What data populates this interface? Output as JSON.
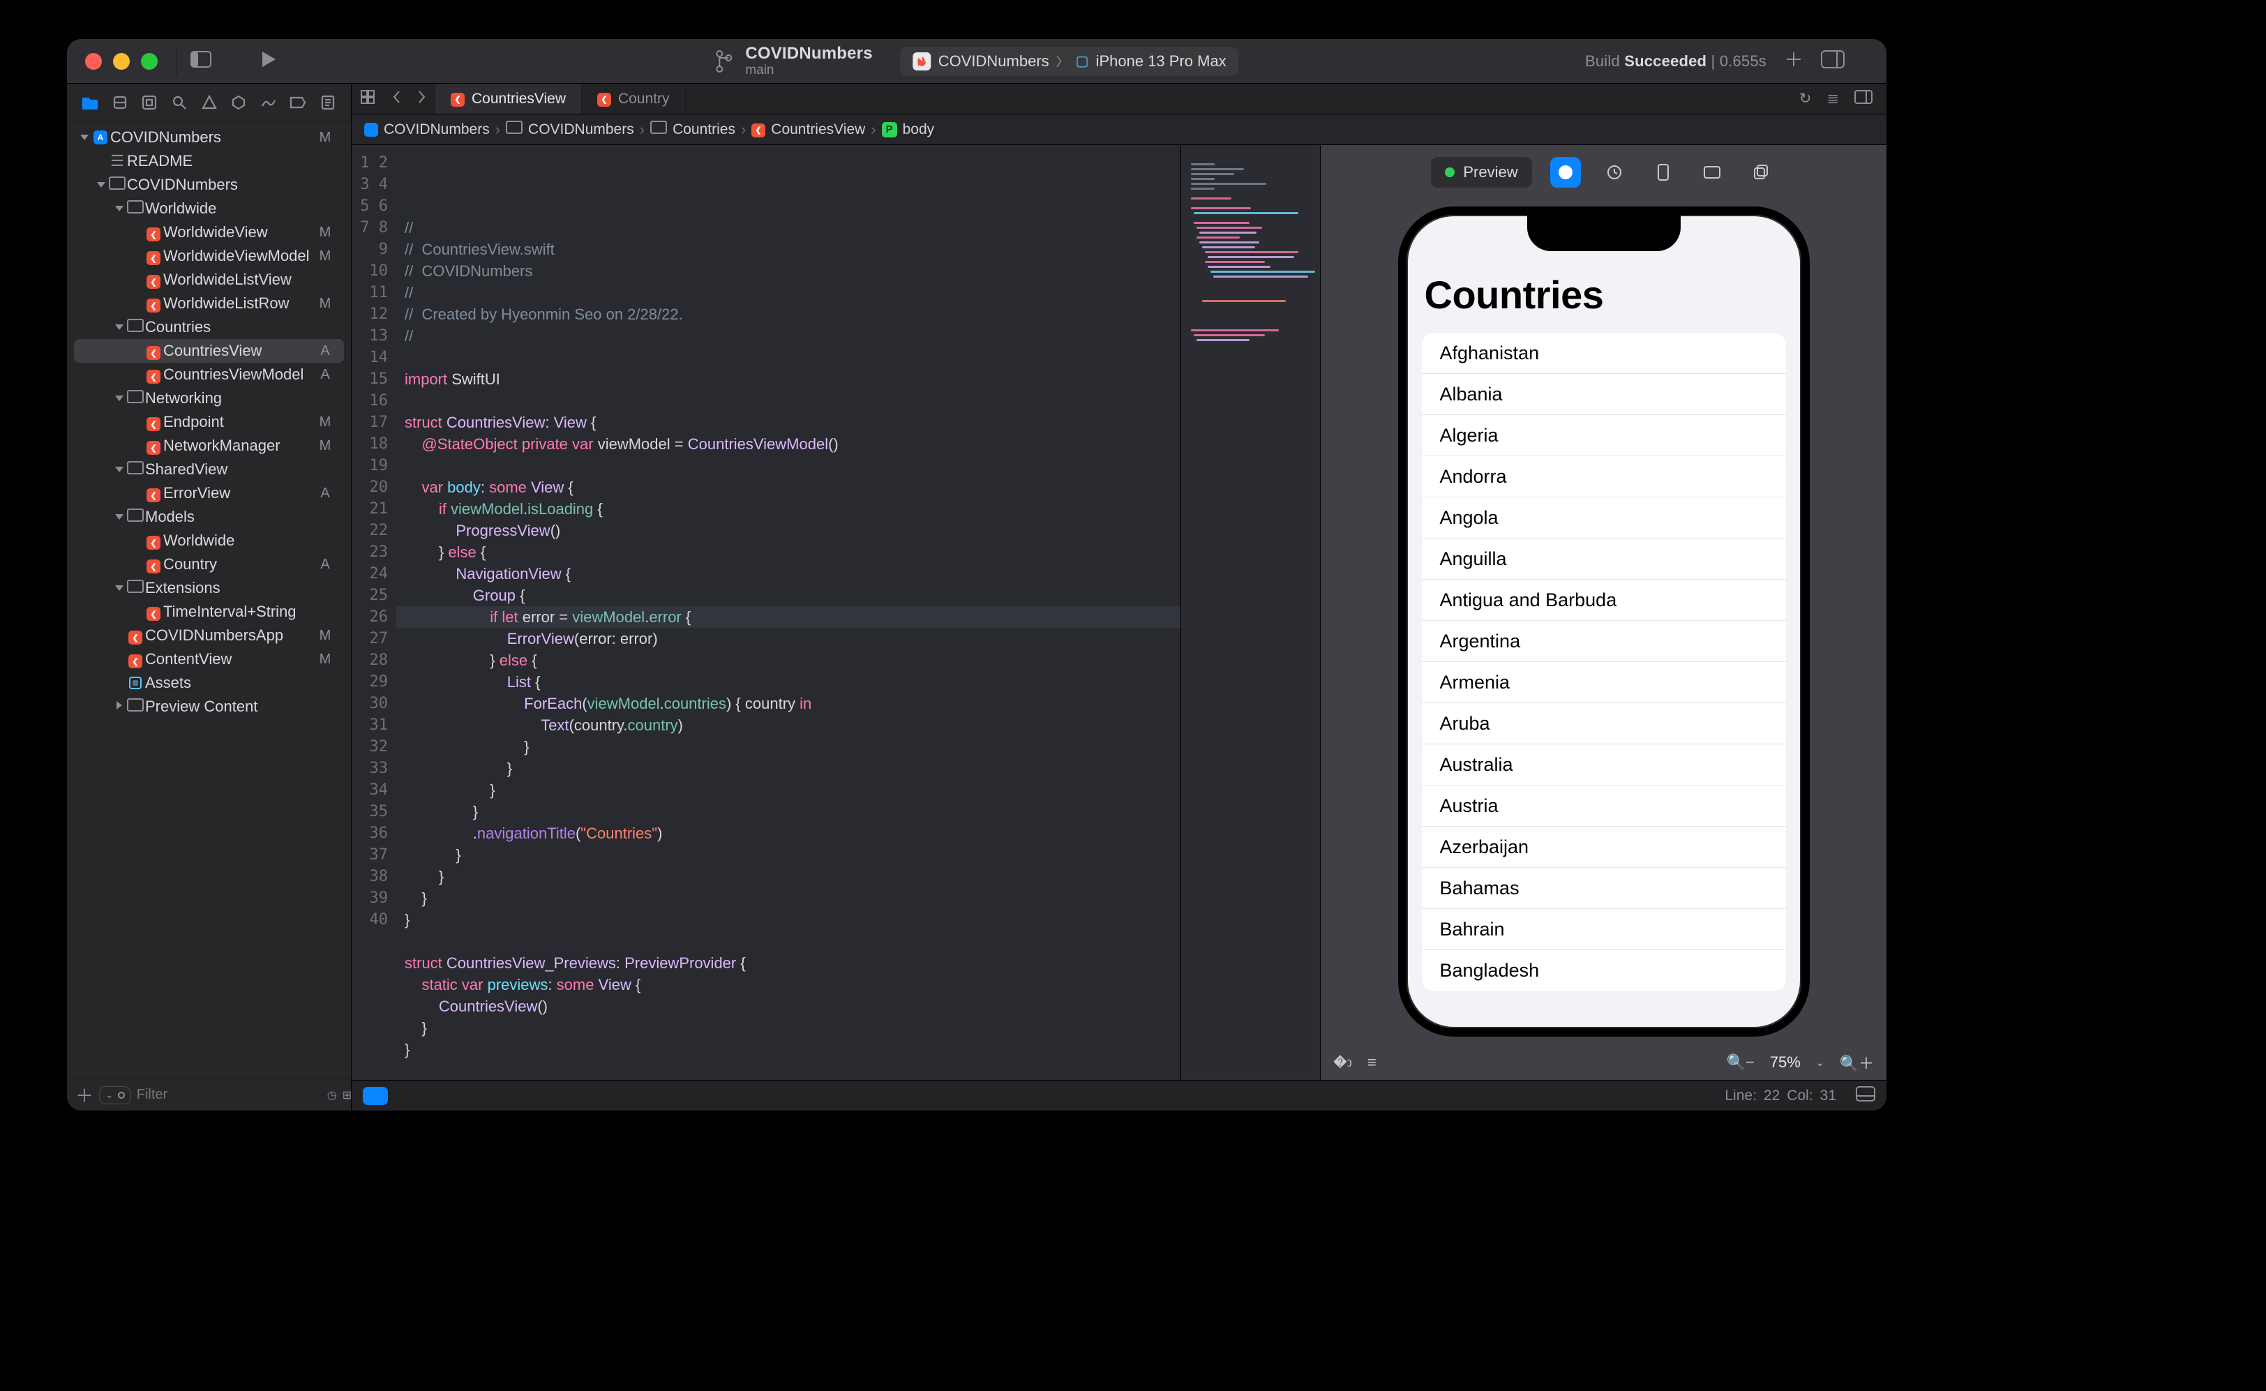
{
  "titlebar": {
    "project_title": "COVIDNumbers",
    "branch": "main",
    "scheme_app": "COVIDNumbers",
    "scheme_device": "iPhone 13 Pro Max",
    "status_prefix": "Build ",
    "status_result": "Succeeded",
    "status_time": " | 0.655s"
  },
  "navigator": {
    "filter_placeholder": "Filter",
    "tree": [
      {
        "indent": 0,
        "kind": "project",
        "label": "COVIDNumbers",
        "badge": "M",
        "open": true
      },
      {
        "indent": 1,
        "kind": "md",
        "label": "README",
        "badge": ""
      },
      {
        "indent": 1,
        "kind": "folder",
        "label": "COVIDNumbers",
        "badge": "",
        "open": true
      },
      {
        "indent": 2,
        "kind": "folder",
        "label": "Worldwide",
        "badge": "",
        "open": true
      },
      {
        "indent": 3,
        "kind": "swift",
        "label": "WorldwideView",
        "badge": "M"
      },
      {
        "indent": 3,
        "kind": "swift",
        "label": "WorldwideViewModel",
        "badge": "M"
      },
      {
        "indent": 3,
        "kind": "swift",
        "label": "WorldwideListView",
        "badge": ""
      },
      {
        "indent": 3,
        "kind": "swift",
        "label": "WorldwideListRow",
        "badge": "M"
      },
      {
        "indent": 2,
        "kind": "folder",
        "label": "Countries",
        "badge": "",
        "open": true
      },
      {
        "indent": 3,
        "kind": "swift",
        "label": "CountriesView",
        "badge": "A",
        "selected": true
      },
      {
        "indent": 3,
        "kind": "swift",
        "label": "CountriesViewModel",
        "badge": "A"
      },
      {
        "indent": 2,
        "kind": "folder",
        "label": "Networking",
        "badge": "",
        "open": true
      },
      {
        "indent": 3,
        "kind": "swift",
        "label": "Endpoint",
        "badge": "M"
      },
      {
        "indent": 3,
        "kind": "swift",
        "label": "NetworkManager",
        "badge": "M"
      },
      {
        "indent": 2,
        "kind": "folder",
        "label": "SharedView",
        "badge": "",
        "open": true
      },
      {
        "indent": 3,
        "kind": "swift",
        "label": "ErrorView",
        "badge": "A"
      },
      {
        "indent": 2,
        "kind": "folder",
        "label": "Models",
        "badge": "",
        "open": true
      },
      {
        "indent": 3,
        "kind": "swift",
        "label": "Worldwide",
        "badge": ""
      },
      {
        "indent": 3,
        "kind": "swift",
        "label": "Country",
        "badge": "A"
      },
      {
        "indent": 2,
        "kind": "folder",
        "label": "Extensions",
        "badge": "",
        "open": true
      },
      {
        "indent": 3,
        "kind": "swift",
        "label": "TimeInterval+String",
        "badge": ""
      },
      {
        "indent": 2,
        "kind": "swift",
        "label": "COVIDNumbersApp",
        "badge": "M"
      },
      {
        "indent": 2,
        "kind": "swift",
        "label": "ContentView",
        "badge": "M"
      },
      {
        "indent": 2,
        "kind": "assets",
        "label": "Assets",
        "badge": ""
      },
      {
        "indent": 2,
        "kind": "folder",
        "label": "Preview Content",
        "badge": "",
        "open": false
      }
    ]
  },
  "tabs": [
    {
      "label": "CountriesView",
      "active": true
    },
    {
      "label": "Country",
      "active": false
    }
  ],
  "jumpbar": [
    "COVIDNumbers",
    "COVIDNumbers",
    "Countries",
    "CountriesView",
    "body"
  ],
  "code": {
    "lines": 40,
    "cursor_line": 22,
    "tokens": [
      [
        [
          "c1",
          "//"
        ]
      ],
      [
        [
          "c1",
          "//  CountriesView.swift"
        ]
      ],
      [
        [
          "c1",
          "//  COVIDNumbers"
        ]
      ],
      [
        [
          "c1",
          "//"
        ]
      ],
      [
        [
          "c1",
          "//  Created by Hyeonmin Seo on 2/28/22."
        ]
      ],
      [
        [
          "c1",
          "//"
        ]
      ],
      [],
      [
        [
          "kw",
          "import"
        ],
        [
          "op",
          " SwiftUI"
        ]
      ],
      [],
      [
        [
          "kw",
          "struct "
        ],
        [
          "ty",
          "CountriesView"
        ],
        [
          "op",
          ": "
        ],
        [
          "ty",
          "View"
        ],
        [
          "op",
          " {"
        ]
      ],
      [
        [
          "op",
          "    "
        ],
        [
          "at",
          "@StateObject"
        ],
        [
          "op",
          " "
        ],
        [
          "kw",
          "private var"
        ],
        [
          "op",
          " "
        ],
        [
          "op",
          "viewModel = "
        ],
        [
          "ty",
          "CountriesViewModel"
        ],
        [
          "op",
          "()"
        ]
      ],
      [],
      [
        [
          "op",
          "    "
        ],
        [
          "kw",
          "var"
        ],
        [
          "op",
          " "
        ],
        [
          "id",
          "body"
        ],
        [
          "op",
          ": "
        ],
        [
          "kw",
          "some"
        ],
        [
          "op",
          " "
        ],
        [
          "ty",
          "View"
        ],
        [
          "op",
          " {"
        ]
      ],
      [
        [
          "op",
          "        "
        ],
        [
          "kw",
          "if"
        ],
        [
          "op",
          " "
        ],
        [
          "va",
          "viewModel"
        ],
        [
          "op",
          "."
        ],
        [
          "va",
          "isLoading"
        ],
        [
          "op",
          " {"
        ]
      ],
      [
        [
          "op",
          "            "
        ],
        [
          "ty",
          "ProgressView"
        ],
        [
          "op",
          "()"
        ]
      ],
      [
        [
          "op",
          "        } "
        ],
        [
          "kw",
          "else"
        ],
        [
          "op",
          " {"
        ]
      ],
      [
        [
          "op",
          "            "
        ],
        [
          "ty",
          "NavigationView"
        ],
        [
          "op",
          " {"
        ]
      ],
      [
        [
          "op",
          "                "
        ],
        [
          "ty",
          "Group"
        ],
        [
          "op",
          " {"
        ]
      ],
      [
        [
          "op",
          "                    "
        ],
        [
          "kw",
          "if let"
        ],
        [
          "op",
          " error = "
        ],
        [
          "va",
          "viewModel"
        ],
        [
          "op",
          "."
        ],
        [
          "va",
          "error"
        ],
        [
          "op",
          " {"
        ]
      ],
      [
        [
          "op",
          "                        "
        ],
        [
          "ty",
          "ErrorView"
        ],
        [
          "op",
          "(error: "
        ],
        [
          "op",
          "error)"
        ]
      ],
      [
        [
          "op",
          "                    } "
        ],
        [
          "kw",
          "else"
        ],
        [
          "op",
          " {"
        ]
      ],
      [
        [
          "op",
          "                        "
        ],
        [
          "ty",
          "List"
        ],
        [
          "op",
          " {"
        ]
      ],
      [
        [
          "op",
          "                            "
        ],
        [
          "ty",
          "ForEach"
        ],
        [
          "op",
          "("
        ],
        [
          "va",
          "viewModel"
        ],
        [
          "op",
          "."
        ],
        [
          "va",
          "countries"
        ],
        [
          "op",
          ") { country "
        ],
        [
          "kw",
          "in"
        ]
      ],
      [
        [
          "op",
          "                                "
        ],
        [
          "ty",
          "Text"
        ],
        [
          "op",
          "("
        ],
        [
          "op",
          "country."
        ],
        [
          "va",
          "country"
        ],
        [
          "op",
          ")"
        ]
      ],
      [
        [
          "op",
          "                            }"
        ]
      ],
      [
        [
          "op",
          "                        }"
        ]
      ],
      [
        [
          "op",
          "                    }"
        ]
      ],
      [
        [
          "op",
          "                }"
        ]
      ],
      [
        [
          "op",
          "                ."
        ],
        [
          "fn",
          "navigationTitle"
        ],
        [
          "op",
          "("
        ],
        [
          "st",
          "\"Countries\""
        ],
        [
          "op",
          ")"
        ]
      ],
      [
        [
          "op",
          "            }"
        ]
      ],
      [
        [
          "op",
          "        }"
        ]
      ],
      [
        [
          "op",
          "    }"
        ]
      ],
      [
        [
          "op",
          "}"
        ]
      ],
      [],
      [
        [
          "kw",
          "struct "
        ],
        [
          "ty",
          "CountriesView_Previews"
        ],
        [
          "op",
          ": "
        ],
        [
          "ty",
          "PreviewProvider"
        ],
        [
          "op",
          " {"
        ]
      ],
      [
        [
          "op",
          "    "
        ],
        [
          "kw",
          "static var"
        ],
        [
          "op",
          " "
        ],
        [
          "id",
          "previews"
        ],
        [
          "op",
          ": "
        ],
        [
          "kw",
          "some"
        ],
        [
          "op",
          " "
        ],
        [
          "ty",
          "View"
        ],
        [
          "op",
          " {"
        ]
      ],
      [
        [
          "op",
          "        "
        ],
        [
          "ty",
          "CountriesView"
        ],
        [
          "op",
          "()"
        ]
      ],
      [
        [
          "op",
          "    }"
        ]
      ],
      [
        [
          "op",
          "}"
        ]
      ],
      []
    ]
  },
  "preview": {
    "label": "Preview",
    "nav_title": "Countries",
    "countries": [
      "Afghanistan",
      "Albania",
      "Algeria",
      "Andorra",
      "Angola",
      "Anguilla",
      "Antigua and Barbuda",
      "Argentina",
      "Armenia",
      "Aruba",
      "Australia",
      "Austria",
      "Azerbaijan",
      "Bahamas",
      "Bahrain",
      "Bangladesh"
    ]
  },
  "canvas_footer": {
    "zoom": "75%"
  },
  "bottombar": {
    "line_label": "Line: ",
    "line": "22",
    "col_label": "  Col: ",
    "col": "31"
  }
}
